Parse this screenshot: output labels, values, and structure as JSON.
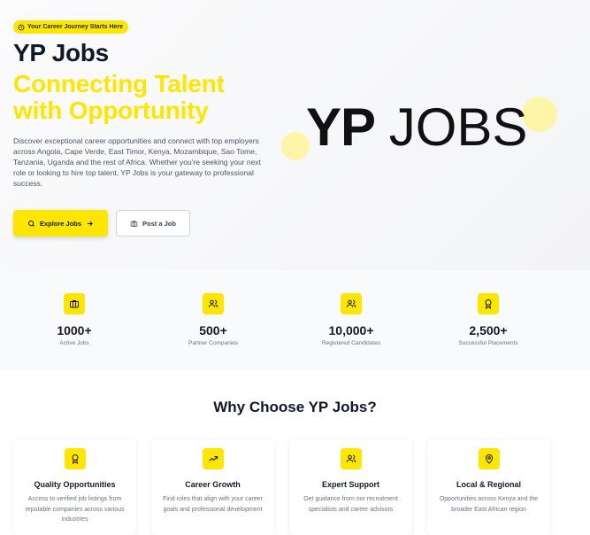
{
  "hero": {
    "badge": "Your Career Journey Starts Here",
    "title": "YP Jobs",
    "subtitle": "Connecting Talent with Opportunity",
    "description": "Discover exceptional career opportunities and connect with top employers across Angola, Cape Verde, East Timor, Kenya, Mozambique, Sao Tome, Tanzania, Uganda and the rest of Africa. Whether you're seeking your next role or looking to hire top talent, YP Jobs is your gateway to professional success.",
    "explore_label": "Explore Jobs",
    "post_label": "Post a Job",
    "logo_yp": "YP",
    "logo_jobs": "JOBS"
  },
  "stats": [
    {
      "value": "1000+",
      "label": "Active Jobs",
      "icon": "briefcase-icon"
    },
    {
      "value": "500+",
      "label": "Partner Companies",
      "icon": "users-icon"
    },
    {
      "value": "10,000+",
      "label": "Registered Candidates",
      "icon": "users-icon"
    },
    {
      "value": "2,500+",
      "label": "Successful Placements",
      "icon": "award-icon"
    }
  ],
  "why": {
    "title": "Why Choose YP Jobs?",
    "cards": [
      {
        "title": "Quality Opportunities",
        "desc": "Access to verified job listings from reputable companies across various industries",
        "icon": "award-icon"
      },
      {
        "title": "Career Growth",
        "desc": "Find roles that align with your career goals and professional development",
        "icon": "trending-up-icon"
      },
      {
        "title": "Expert Support",
        "desc": "Get guidance from our recruitment specialists and career advisors",
        "icon": "users-icon"
      },
      {
        "title": "Local & Regional",
        "desc": "Opportunities across Kenya and the broader East African region",
        "icon": "map-pin-icon"
      }
    ]
  },
  "colors": {
    "accent": "#ffe600",
    "text": "#111827",
    "muted": "#6b7280"
  }
}
